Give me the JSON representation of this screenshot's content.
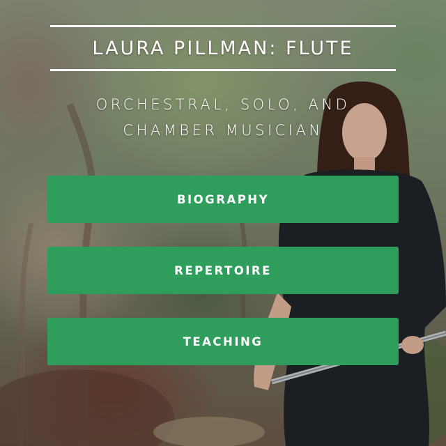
{
  "header": {
    "title": "LAURA PILLMAN: FLUTE"
  },
  "subtitle": {
    "line1": "ORCHESTRAL, SOLO, AND",
    "line2": "CHAMBER MUSICIAN"
  },
  "nav": {
    "buttons": [
      {
        "label": "BIOGRAPHY"
      },
      {
        "label": "REPERTOIRE"
      },
      {
        "label": "TEACHING"
      }
    ]
  },
  "colors": {
    "button_green": "#2f9e5c",
    "text": "#ffffff"
  }
}
